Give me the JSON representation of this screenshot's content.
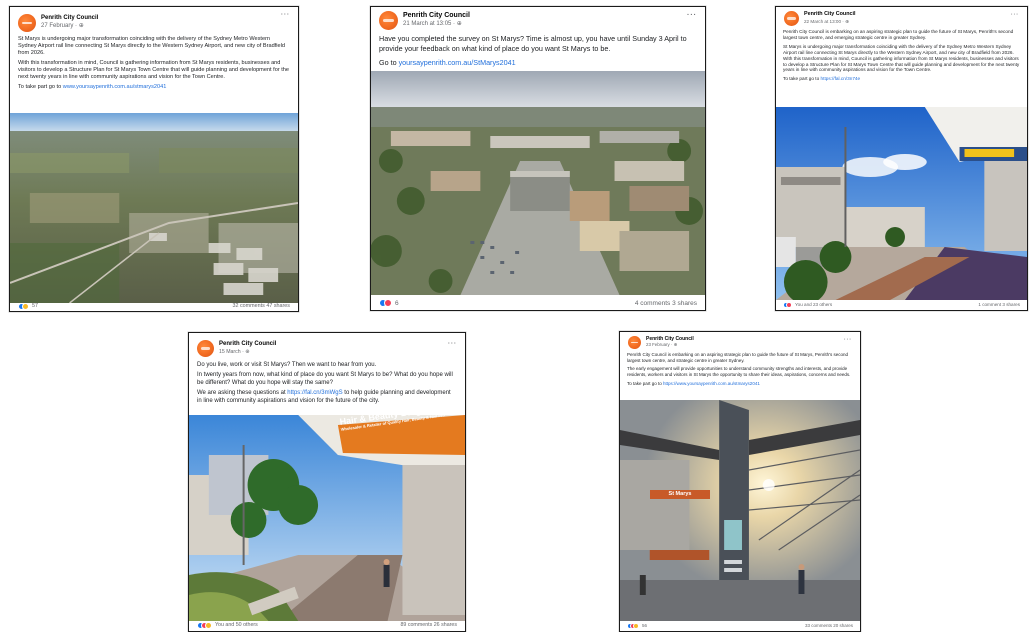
{
  "posts": [
    {
      "page": "Penrith City Council",
      "time": "27 February · ",
      "paragraphs": [
        "St Marys is undergoing major transformation coinciding with the delivery of the Sydney Metro Western Sydney Airport rail line connecting St Marys directly to the Western Sydney Airport, and new city of Bradfield from 2026.",
        "With this transformation in mind, Council is gathering information from St Marys residents, businesses and visitors to develop a Structure Plan for St Marys Town Centre  that will guide planning and development for the next twenty years in line with community aspirations and vision for the Town Centre."
      ],
      "cta": "To take part go to ",
      "link": "www.yoursaypenrith.com.au/stmarys2041",
      "reactions": "57",
      "stats": "32 comments  47 shares"
    },
    {
      "page": "Penrith City Council",
      "time": "21 March at 13:05 · ",
      "paragraphs": [
        "Have you completed the survey on St Marys? Time is almost up, you have until Sunday 3 April to provide your feedback on what kind of place do you want St Marys to be."
      ],
      "cta": "Go to ",
      "link": "yoursaypenrith.com.au/StMarys2041",
      "reactions": "6",
      "stats": "4 comments  3 shares"
    },
    {
      "page": "Penrith City Council",
      "time": "22 March at 13:00 · ",
      "paragraphs": [
        "Penrith City Council is embarking on an aspiring strategic plan to guide the future of St Marys, Penrith's second largest town centre, and emerging strategic centre in greater Sydney.",
        "St Marys is undergoing major transformation coinciding with the delivery of the Sydney Metro Western Sydney Airport rail line connecting St Marys directly to the Western Sydney Airport, and new city of Bradfield from 2026.  With this transformation in mind, Council is gathering information from St Marys residents, businesses and visitors to develop a Structure Plan for St Marys Town Centre that will guide planning and development for the next twenty years in line with community aspirations and vision for the Town Centre."
      ],
      "cta": "To take part go to ",
      "link": "https://fal.cn/3n74e",
      "reactions": "You and 23 others",
      "stats": "1 comment  3 shares"
    },
    {
      "page": "Penrith City Council",
      "time": "15 March · ",
      "paragraphs": [
        "Do you live, work or visit St Marys? Then we want to hear from you.",
        "In twenty years from now, what kind of place do you want St Marys to be? What do you hope will be different? What do you hope will stay the same?"
      ],
      "cta": "We are asking these questions at ",
      "link": "https://fal.cn/3mWgS",
      "cta_after": " to help guide planning and development in line with community aspirations and vision for the future of the city.",
      "reactions": "You and 50 others",
      "stats": "89 comments  26 shares",
      "sign_line1": "Hair & Beauty Bargain Bazaar",
      "sign_line2": "Wholesaler & Retailer of Quality Hair, Beauty & Nail Pro"
    },
    {
      "page": "Penrith City Council",
      "time": "23 February · ",
      "paragraphs": [
        "Penrith City Council is embarking on an aspiring strategic plan to guide the future of St Marys, Penrith's second largest town centre, and strategic centre in greater Sydney.",
        "The early engagement will provide opportunities to understand community strengths and interests, and provide residents, workers and visitors in St Marys the opportunity to share their ideas, aspirations, concerns and needs."
      ],
      "cta": "To take part go to ",
      "link": "https://www.yoursaypenrith.com.au/stmarys2041",
      "reactions": "56",
      "stats": "33 comments  20 shares",
      "sign": "St Marys"
    }
  ],
  "menu_icon": "···",
  "colors": {
    "link": "#216fdb",
    "brand": "#f26b21",
    "like": "#1877f2",
    "love": "#f33e58"
  }
}
